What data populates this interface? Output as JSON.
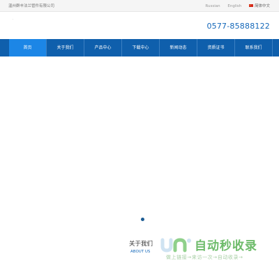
{
  "topbar": {
    "company": "温州群丰法兰管件有限公司",
    "languages": [
      "Russian",
      "English",
      "简体中文"
    ]
  },
  "header": {
    "phone": "0577-85888122"
  },
  "nav": {
    "items": [
      "首页",
      "关于我们",
      "产品中心",
      "下载中心",
      "新闻动态",
      "资质证书",
      "联系我们"
    ],
    "active_index": 0
  },
  "about": {
    "title": "关于我们",
    "subtitle": "ABOUT US"
  },
  "watermark": {
    "title": "自动秒收录",
    "subtitle": "做上链接→来访一次→自动收录→"
  },
  "colors": {
    "nav_bg": "#0f5fac",
    "nav_active": "#1c86e6",
    "phone": "#1367b9",
    "watermark": "#6dbb6a"
  }
}
